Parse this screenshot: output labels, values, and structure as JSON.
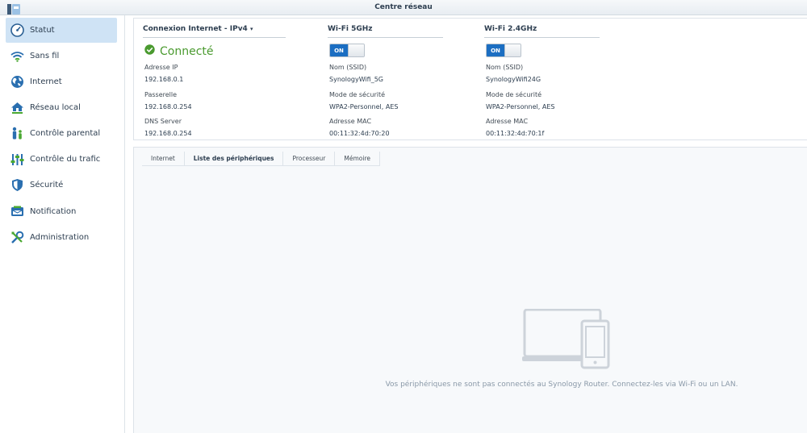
{
  "window": {
    "title": "Centre réseau"
  },
  "sidebar": {
    "items": [
      {
        "label": "Statut",
        "icon": "gauge-icon",
        "active": true
      },
      {
        "label": "Sans fil",
        "icon": "wifi-icon",
        "active": false
      },
      {
        "label": "Internet",
        "icon": "globe-icon",
        "active": false
      },
      {
        "label": "Réseau local",
        "icon": "house-network-icon",
        "active": false
      },
      {
        "label": "Contrôle parental",
        "icon": "family-icon",
        "active": false
      },
      {
        "label": "Contrôle du trafic",
        "icon": "sliders-icon",
        "active": false
      },
      {
        "label": "Sécurité",
        "icon": "shield-icon",
        "active": false
      },
      {
        "label": "Notification",
        "icon": "message-icon",
        "active": false
      },
      {
        "label": "Administration",
        "icon": "tools-icon",
        "active": false
      }
    ]
  },
  "internet": {
    "title": "Connexion Internet",
    "protocol": "IPv4",
    "status": "Connecté",
    "ip_label": "Adresse IP",
    "ip_value": "192.168.0.1",
    "gateway_label": "Passerelle",
    "gateway_value": "192.168.0.254",
    "dns_label": "DNS Server",
    "dns_value": "192.168.0.254"
  },
  "wifi5": {
    "title": "Wi-Fi 5GHz",
    "toggle": "ON",
    "ssid_label": "Nom (SSID)",
    "ssid_value": "SynologyWifi_5G",
    "security_label": "Mode de sécurité",
    "security_value": "WPA2-Personnel, AES",
    "mac_label": "Adresse MAC",
    "mac_value": "00:11:32:4d:70:20"
  },
  "wifi24": {
    "title": "Wi-Fi 2.4GHz",
    "toggle": "ON",
    "ssid_label": "Nom (SSID)",
    "ssid_value": "SynologyWifi24G",
    "security_label": "Mode de sécurité",
    "security_value": "WPA2-Personnel, AES",
    "mac_label": "Adresse MAC",
    "mac_value": "00:11:32:4d:70:1f"
  },
  "tabs": [
    {
      "label": "Internet",
      "active": false
    },
    {
      "label": "Liste des périphériques",
      "active": true
    },
    {
      "label": "Processeur",
      "active": false
    },
    {
      "label": "Mémoire",
      "active": false
    }
  ],
  "empty_state": {
    "message": "Vos périphériques ne sont pas connectés au Synology Router. Connectez-les via Wi-Fi ou un LAN."
  },
  "colors": {
    "accent": "#1b6ec2",
    "connected": "#4a9a2f",
    "sidebar_active": "#cfe3f5"
  }
}
